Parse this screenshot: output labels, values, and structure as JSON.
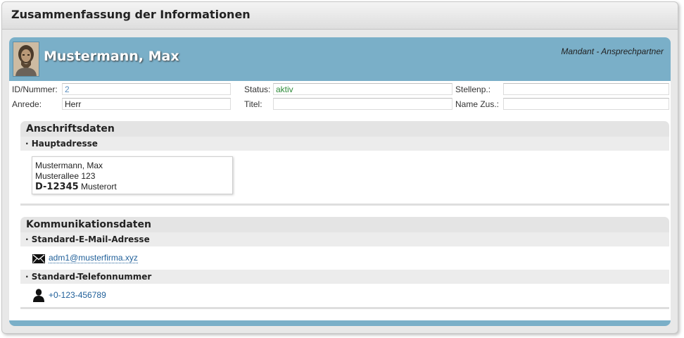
{
  "window": {
    "title": "Zusammenfassung der Informationen"
  },
  "header": {
    "name": "Mustermann, Max",
    "role": "Mandant - Ansprechpartner",
    "avatar_icon": "person-photo"
  },
  "fields": {
    "id_label": "ID/Nummer:",
    "id_value": "2",
    "status_label": "Status:",
    "status_value": "aktiv",
    "stellenp_label": "Stellenp.:",
    "stellenp_value": "",
    "anrede_label": "Anrede:",
    "anrede_value": "Herr",
    "titel_label": "Titel:",
    "titel_value": "",
    "namezus_label": "Name Zus.:",
    "namezus_value": ""
  },
  "address": {
    "section_title": "Anschriftsdaten",
    "sub_title": "· Hauptadresse",
    "line1": "Mustermann, Max",
    "line2": "Musterallee 123",
    "zip": "D-12345",
    "city": "Musterort"
  },
  "communication": {
    "section_title": "Kommunikationsdaten",
    "email_title": "· Standard-E-Mail-Adresse",
    "email": "adm1@musterfirma.xyz",
    "email_icon": "envelope-icon",
    "phone_title": "· Standard-Telefonnummer",
    "phone": "+0-123-456789",
    "phone_icon": "person-icon"
  },
  "colors": {
    "header_bg": "#7aafc8",
    "link": "#1f5f99",
    "status_active": "#2e8b3a",
    "id_value": "#5b8fbf"
  }
}
